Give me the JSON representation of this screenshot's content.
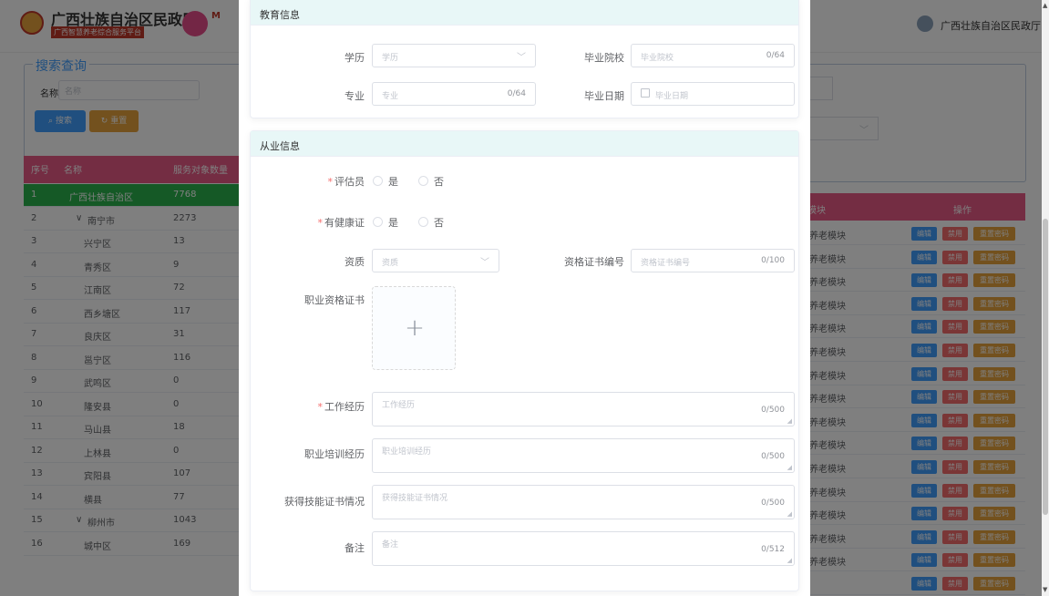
{
  "header": {
    "org_title": "广西壮族自治区民政厅",
    "org_subtitle": "广西智慧养老综合服务平台",
    "logo3_text": "M",
    "user_name": "广西壮族自治区民政厅"
  },
  "search": {
    "legend": "搜索查询",
    "name_label": "名称",
    "name_placeholder": "名称",
    "search_button": "搜索",
    "reset_button": "重置"
  },
  "table": {
    "headers": [
      "序号",
      "名称",
      "服务对象数量"
    ],
    "rows": [
      {
        "no": "1",
        "name": "广西壮族自治区",
        "count": "7768"
      },
      {
        "no": "2",
        "name": "南宁市",
        "count": "2273"
      },
      {
        "no": "3",
        "name": "兴宁区",
        "count": "13"
      },
      {
        "no": "4",
        "name": "青秀区",
        "count": "9"
      },
      {
        "no": "5",
        "name": "江南区",
        "count": "72"
      },
      {
        "no": "6",
        "name": "西乡塘区",
        "count": "117"
      },
      {
        "no": "7",
        "name": "良庆区",
        "count": "31"
      },
      {
        "no": "8",
        "name": "邕宁区",
        "count": "116"
      },
      {
        "no": "9",
        "name": "武鸣区",
        "count": "0"
      },
      {
        "no": "10",
        "name": "隆安县",
        "count": "0"
      },
      {
        "no": "11",
        "name": "马山县",
        "count": "18"
      },
      {
        "no": "12",
        "name": "上林县",
        "count": "0"
      },
      {
        "no": "13",
        "name": "宾阳县",
        "count": "107"
      },
      {
        "no": "14",
        "name": "横县",
        "count": "77"
      },
      {
        "no": "15",
        "name": "柳州市",
        "count": "1043"
      },
      {
        "no": "16",
        "name": "城中区",
        "count": "169"
      }
    ],
    "right_header_module": "模块",
    "right_header_ops": "操作",
    "module_text": "养老模块",
    "edit_label": "编辑",
    "disable_label": "禁用",
    "reset_pw_label": "重置密码"
  },
  "dialog": {
    "education_title": "教育信息",
    "work_title": "从业信息",
    "education": {
      "degree_label": "学历",
      "degree_placeholder": "学历",
      "school_label": "毕业院校",
      "school_placeholder": "毕业院校",
      "school_count": "0/64",
      "major_label": "专业",
      "major_placeholder": "专业",
      "major_count": "0/64",
      "grad_date_label": "毕业日期",
      "grad_date_placeholder": "毕业日期"
    },
    "work": {
      "assessor_label": "评估员",
      "health_cert_label": "有健康证",
      "yes": "是",
      "no": "否",
      "qualification_label": "资质",
      "qualification_placeholder": "资质",
      "cert_no_label": "资格证书编号",
      "cert_no_placeholder": "资格证书编号",
      "cert_no_count": "0/100",
      "cert_upload_label": "职业资格证书",
      "upload_plus": "+",
      "experience_label": "工作经历",
      "experience_placeholder": "工作经历",
      "experience_count": "0/500",
      "training_label": "职业培训经历",
      "training_placeholder": "职业培训经历",
      "training_count": "0/500",
      "skill_label": "获得技能证书情况",
      "skill_placeholder": "获得技能证书情况",
      "skill_count": "0/500",
      "remark_label": "备注",
      "remark_placeholder": "备注",
      "remark_count": "0/512"
    }
  },
  "colors": {
    "primary": "#409eff",
    "danger": "#f56c6c",
    "warning": "#e6a23c",
    "table_header": "#e85a86",
    "selected_row": "#2bb24c",
    "card_header": "#e8f7f7"
  }
}
